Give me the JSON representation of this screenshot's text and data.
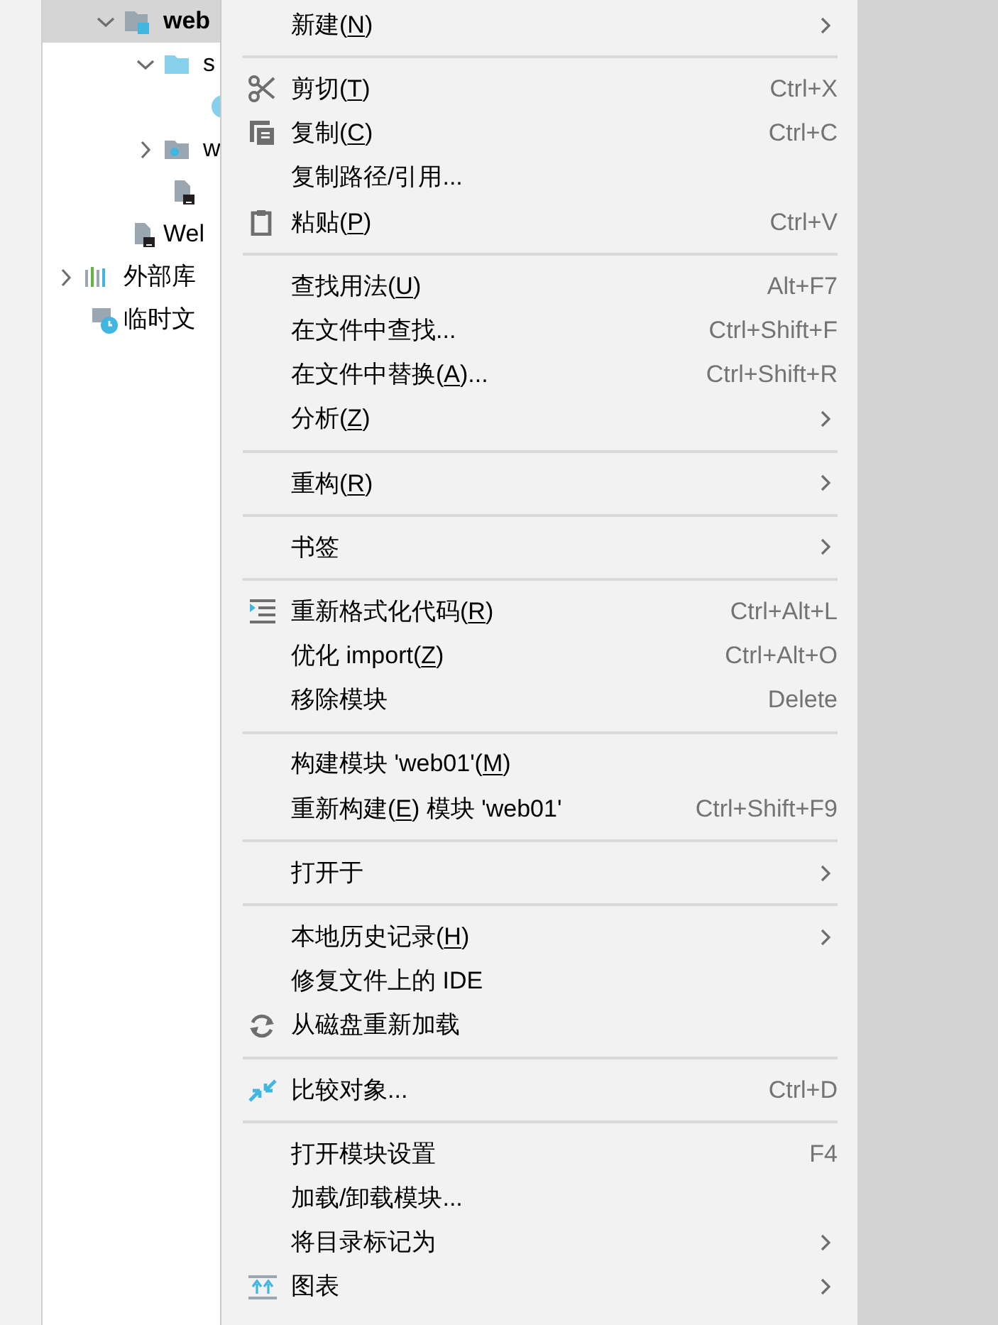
{
  "tree": {
    "root_children": [
      {
        "kind": "module",
        "label": "web",
        "selected": true,
        "expanded": true,
        "children": [
          {
            "kind": "folder",
            "label": "s",
            "selected": false,
            "expanded": true,
            "children": [
              {
                "kind": "circle",
                "selected": false
              }
            ]
          },
          {
            "kind": "web_folder",
            "label": "w",
            "selected": false,
            "expanded": false
          },
          {
            "kind": "file",
            "selected": false
          }
        ]
      },
      {
        "kind": "file",
        "label": "Wel",
        "selected": false
      }
    ],
    "items": [
      {
        "kind": "library",
        "label": "外部库",
        "selected": false,
        "expanded": false
      },
      {
        "kind": "scratch",
        "label": "临时文",
        "selected": false
      }
    ]
  },
  "menu": [
    {
      "kind": "item",
      "label": "新建(",
      "mnemonic": "N",
      "label_end": ")",
      "submenu": true
    },
    {
      "kind": "separator"
    },
    {
      "kind": "cut",
      "label": "剪切(",
      "mnemonic": "T",
      "label_end": ")",
      "shortcut": "Ctrl+X"
    },
    {
      "kind": "copy",
      "label": "复制(",
      "mnemonic": "C",
      "label_end": ")",
      "shortcut": "Ctrl+C"
    },
    {
      "kind": "item",
      "label": "复制路径/引用..."
    },
    {
      "kind": "paste",
      "label": "粘贴(",
      "mnemonic": "P",
      "label_end": ")",
      "shortcut": "Ctrl+V"
    },
    {
      "kind": "separator"
    },
    {
      "kind": "item",
      "label": "查找用法(",
      "mnemonic": "U",
      "label_end": ")",
      "shortcut": "Alt+F7"
    },
    {
      "kind": "item",
      "label": "在文件中查找...",
      "shortcut": "Ctrl+Shift+F"
    },
    {
      "kind": "item",
      "label": "在文件中替换(",
      "mnemonic": "A",
      "label_end": ")...",
      "shortcut": "Ctrl+Shift+R"
    },
    {
      "kind": "item",
      "label": "分析(",
      "mnemonic": "Z",
      "label_end": ")",
      "submenu": true
    },
    {
      "kind": "separator"
    },
    {
      "kind": "item",
      "label": "重构(",
      "mnemonic": "R",
      "label_end": ")",
      "submenu": true
    },
    {
      "kind": "separator"
    },
    {
      "kind": "item",
      "label": "书签",
      "submenu": true
    },
    {
      "kind": "separator"
    },
    {
      "kind": "reformat",
      "label": "重新格式化代码(",
      "mnemonic": "R",
      "label_end": ")",
      "shortcut": "Ctrl+Alt+L"
    },
    {
      "kind": "item",
      "label": "优化 import(",
      "mnemonic": "Z",
      "label_end": ")",
      "shortcut": "Ctrl+Alt+O"
    },
    {
      "kind": "item",
      "label": "移除模块",
      "shortcut": "Delete"
    },
    {
      "kind": "separator"
    },
    {
      "kind": "item",
      "label": "构建模块 'web01'(",
      "mnemonic": "M",
      "label_end": ")"
    },
    {
      "kind": "item",
      "label": "重新构建(",
      "mnemonic": "E",
      "label_end": ") 模块 'web01'",
      "shortcut": "Ctrl+Shift+F9"
    },
    {
      "kind": "separator"
    },
    {
      "kind": "item",
      "label": "打开于",
      "submenu": true
    },
    {
      "kind": "separator"
    },
    {
      "kind": "item",
      "label": "本地历史记录(",
      "mnemonic": "H",
      "label_end": ")",
      "submenu": true
    },
    {
      "kind": "item",
      "label": "修复文件上的 IDE"
    },
    {
      "kind": "reload",
      "label": "从磁盘重新加载"
    },
    {
      "kind": "separator"
    },
    {
      "kind": "compare",
      "label": "比较对象...",
      "shortcut": "Ctrl+D"
    },
    {
      "kind": "separator"
    },
    {
      "kind": "item",
      "label": "打开模块设置",
      "shortcut": "F4"
    },
    {
      "kind": "item",
      "label": "加载/卸载模块..."
    },
    {
      "kind": "item",
      "label": "将目录标记为",
      "submenu": true
    },
    {
      "kind": "diagram",
      "label": "图表",
      "submenu": true
    }
  ]
}
